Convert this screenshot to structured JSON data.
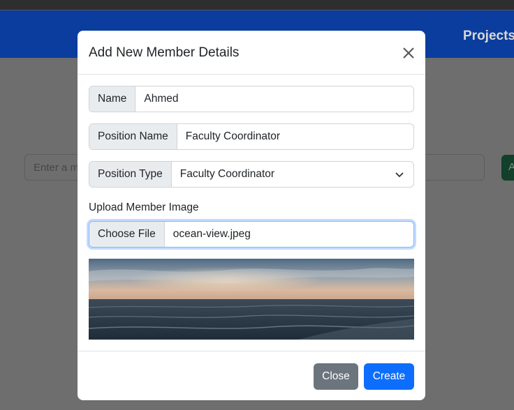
{
  "background": {
    "nav_items": [
      "Projects"
    ],
    "search_placeholder": "Enter a m",
    "button_label": "A"
  },
  "modal": {
    "title": "Add New Member Details",
    "fields": {
      "name": {
        "label": "Name",
        "value": "Ahmed"
      },
      "position_name": {
        "label": "Position Name",
        "value": "Faculty Coordinator"
      },
      "position_type": {
        "label": "Position Type",
        "value": "Faculty Coordinator"
      }
    },
    "upload": {
      "label": "Upload Member Image",
      "choose_label": "Choose File",
      "file_name": "ocean-view.jpeg"
    },
    "footer": {
      "close_label": "Close",
      "create_label": "Create"
    }
  },
  "colors": {
    "navbar": "#0a3d9e",
    "primary": "#0d6efd",
    "secondary": "#6c757d",
    "backdrop": "#6b6b6b"
  }
}
